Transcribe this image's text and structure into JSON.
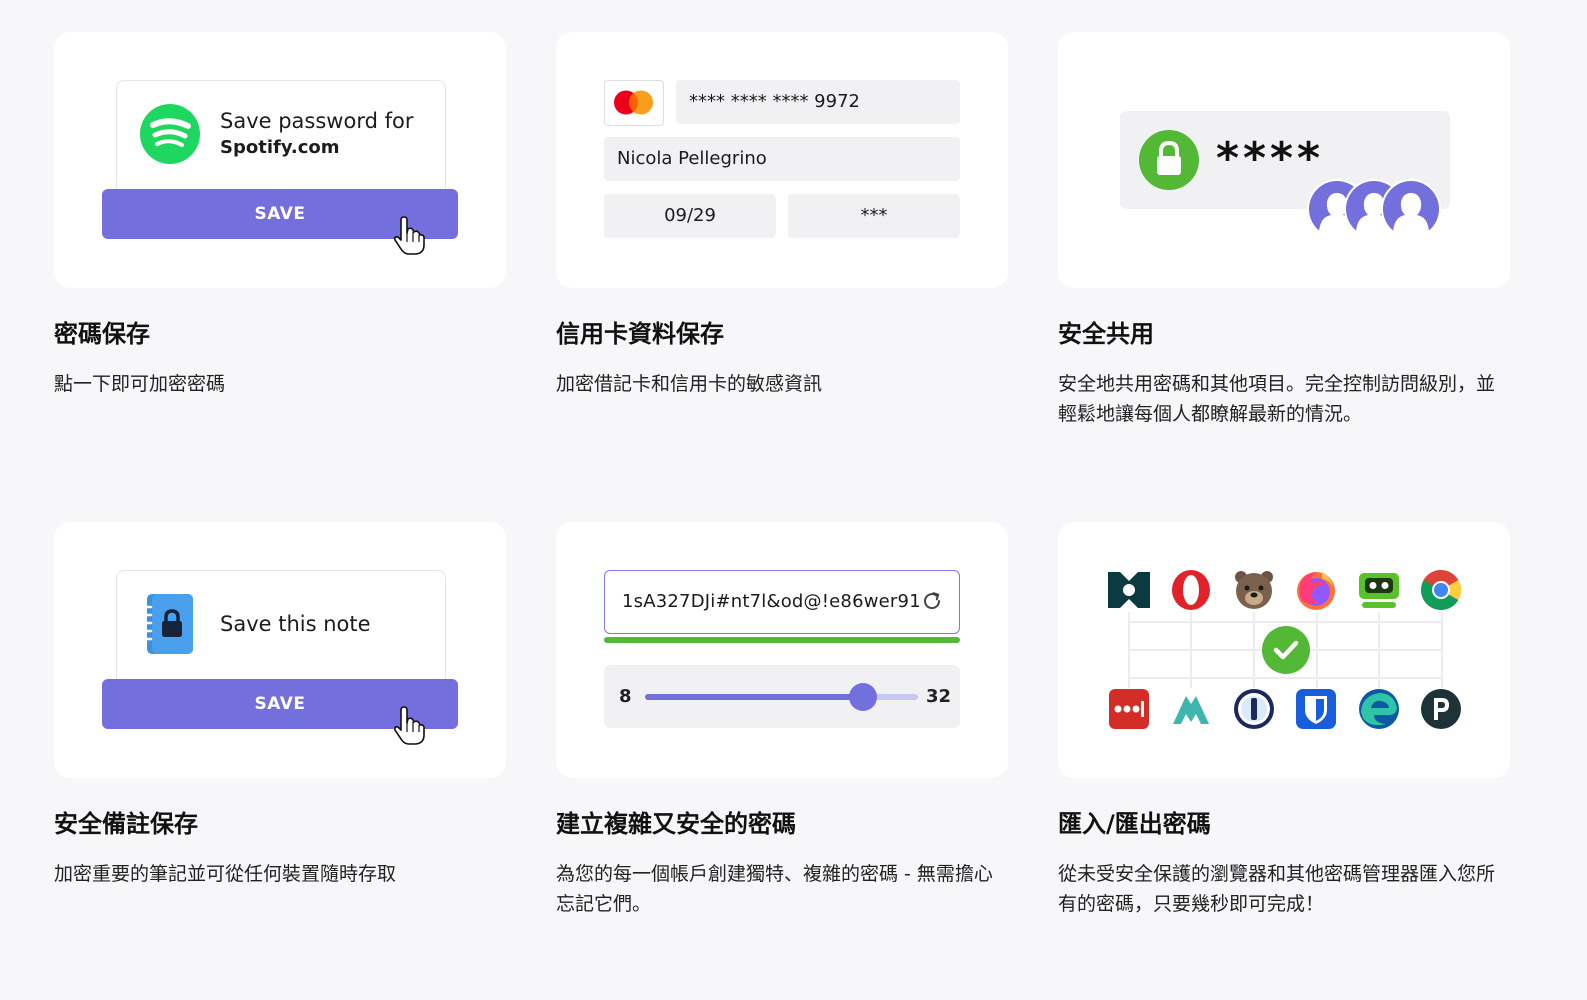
{
  "features": [
    {
      "title": "密碼保存",
      "desc": "點一下即可加密密碼",
      "popup": {
        "line1": "Save password for",
        "line2": "Spotify.com",
        "icon": "spotify-icon"
      },
      "button": "SAVE"
    },
    {
      "title": "信用卡資料保存",
      "desc": "加密借記卡和信用卡的敏感資訊",
      "card": {
        "number": "**** **** **** 9972",
        "name": "Nicola Pellegrino",
        "expiry": "09/29",
        "cvv": "***",
        "icon": "mastercard-icon"
      }
    },
    {
      "title": "安全共用",
      "desc": "安全地共用密碼和其他項目。完全控制訪問級別，並輕鬆地讓每個人都瞭解最新的情況。",
      "masked": "****",
      "icons": [
        "lock-icon",
        "user-avatar-icon",
        "user-avatar-icon",
        "user-avatar-icon"
      ]
    },
    {
      "title": "安全備註保存",
      "desc": "加密重要的筆記並可從任何裝置隨時存取",
      "popup": {
        "line1": "Save this note",
        "icon": "notebook-lock-icon"
      },
      "button": "SAVE"
    },
    {
      "title": "建立複雜又安全的密碼",
      "desc": "為您的每一個帳戶創建獨特、複雜的密碼 - 無需擔心忘記它們。",
      "generator": {
        "password": "1sA327DJi#nt7l&od@!e86wer91",
        "min": "8",
        "max": "32",
        "level": 0.8,
        "icon": "refresh-icon"
      }
    },
    {
      "title": "匯入/匯出密碼",
      "desc": "從未受安全保護的瀏覽器和其他密碼管理器匯入您所有的密碼，只要幾秒即可完成！",
      "browsers_top": [
        "dashlane-icon",
        "opera-icon",
        "roboform-icon",
        "firefox-icon",
        "robot-icon",
        "chrome-icon"
      ],
      "browsers_bottom": [
        "lastpass-icon",
        "nordpass-icon",
        "1password-icon",
        "bitwarden-icon",
        "edge-icon",
        "keeper-icon"
      ],
      "center_icon": "check-icon"
    }
  ],
  "colors": {
    "accent": "#7370dd",
    "green": "#53b836",
    "spotify": "#1ed760"
  }
}
